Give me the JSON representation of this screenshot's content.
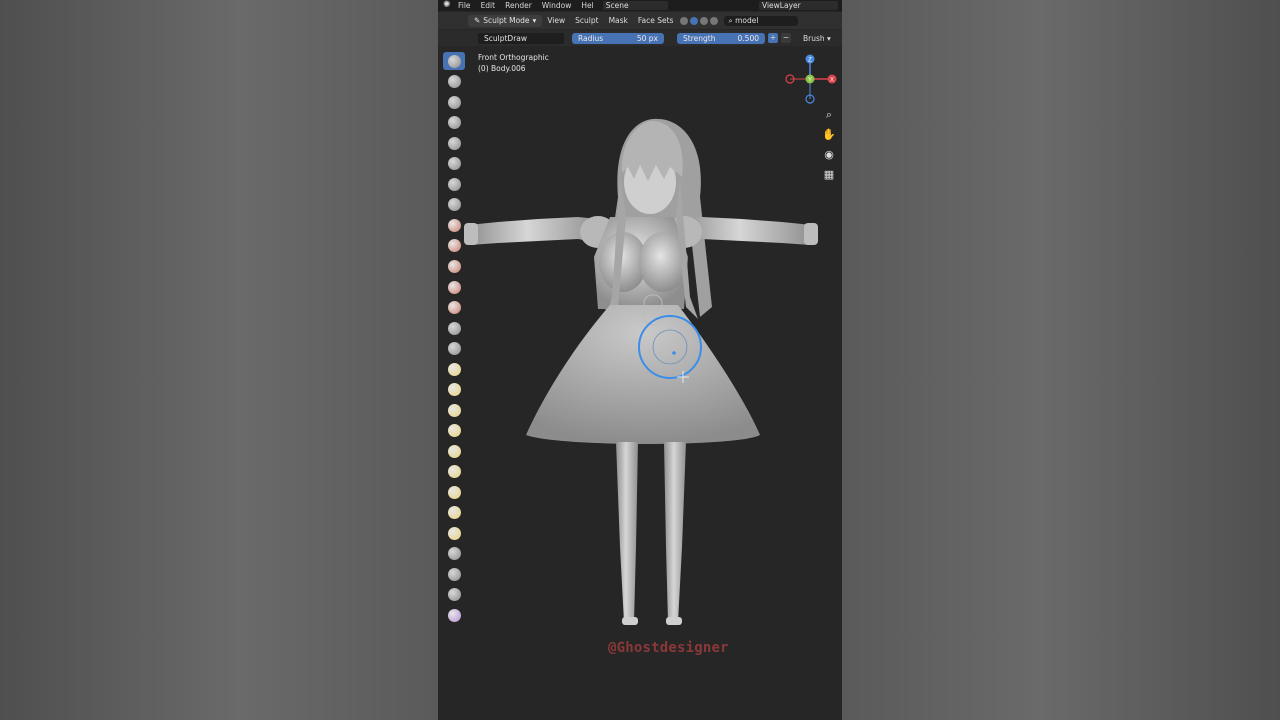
{
  "menu": {
    "file": "File",
    "edit": "Edit",
    "render": "Render",
    "window": "Window",
    "help": "Hel",
    "scene": "Scene",
    "view_layer": "ViewLayer"
  },
  "header": {
    "mode": "Sculpt Mode",
    "view": "View",
    "sculpt": "Sculpt",
    "mask": "Mask",
    "face_sets": "Face Sets",
    "search_value": "model"
  },
  "tool_settings": {
    "brush_name": "SculptDraw",
    "radius_label": "Radius",
    "radius_value": "50 px",
    "strength_label": "Strength",
    "strength_value": "0.500",
    "brush_menu": "Brush",
    "plus": "+",
    "minus": "−"
  },
  "viewport": {
    "projection": "Front Orthographic",
    "object": "(0) Body.006",
    "gizmo": {
      "z": "Z",
      "y": "Y",
      "x": "X"
    }
  },
  "toolbar": {
    "active_tool": "draw",
    "tools": [
      "draw",
      "draw-sharp",
      "clay",
      "clay-strips",
      "clay-thumb",
      "layer",
      "inflate",
      "blob",
      "crease",
      "smooth",
      "flatten",
      "fill",
      "scrape",
      "multiplane-scrape",
      "pinch",
      "grab",
      "elastic-deform",
      "snake-hook",
      "thumb",
      "pose",
      "nudge",
      "rotate",
      "slide-relax",
      "boundary",
      "cloth",
      "simplify",
      "mask",
      "draw-face-sets"
    ]
  },
  "nav": {
    "zoom": "zoom-icon",
    "pan": "pan-hand-icon",
    "camera": "camera-icon",
    "grid": "grid-icon"
  },
  "watermark": "@Ghostdesigner",
  "colors": {
    "accent": "#4772b3",
    "axis_x": "#d9434b",
    "axis_y": "#8bc34a",
    "axis_z": "#4a8ae0",
    "brush_circle": "#3b8ee8",
    "watermark": "#8a3838"
  }
}
